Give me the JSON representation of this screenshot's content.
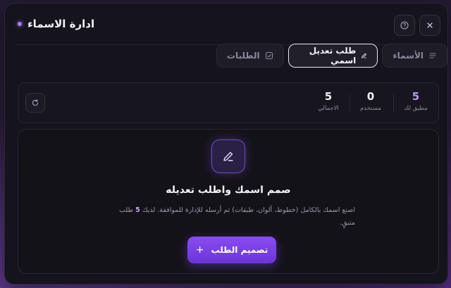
{
  "modal": {
    "title": "ادارة الاسماء"
  },
  "tabs": [
    {
      "label": "الأسماء",
      "icon": "list-icon",
      "active": false
    },
    {
      "label": "طلب تعديل اسمي",
      "icon": "pencil-icon",
      "active": true
    },
    {
      "label": "الطلبات",
      "icon": "checkbox-icon",
      "active": false
    }
  ],
  "stats": {
    "approved": {
      "value": "5",
      "label": "مطبق لك"
    },
    "used": {
      "value": "0",
      "label": "مستخدم"
    },
    "total": {
      "value": "5",
      "label": "الاجمالي"
    }
  },
  "card": {
    "title": "صمم اسمك واطلب تعديله",
    "desc_pre": "اصنع اسمك بالكامل (خطوط، ألوان، طبقات) ثم أرسله للإدارة للموافقة. لديك",
    "desc_count": "5",
    "desc_post": "طلب متبقٍ.",
    "cta_label": "تصميم الطلب",
    "cta_icon": "+"
  },
  "colors": {
    "accent": "#8a4cf0",
    "accent_light": "#b798f5",
    "panel": "#15131c"
  }
}
